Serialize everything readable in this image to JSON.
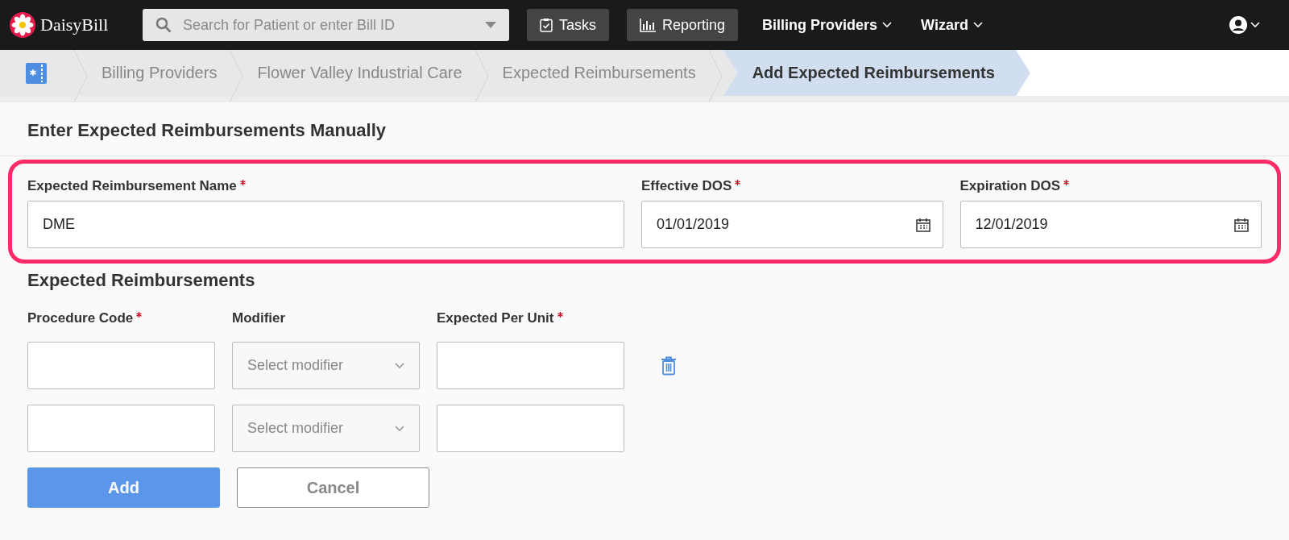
{
  "nav": {
    "logo": "DaisyBill",
    "search": {
      "placeholder": "Search for Patient or enter Bill ID"
    },
    "buttons": [
      {
        "label": "Tasks",
        "kind": "tasks"
      },
      {
        "label": "Reporting",
        "kind": "reporting"
      }
    ],
    "menus": [
      {
        "label": "Billing Providers"
      },
      {
        "label": "Wizard"
      }
    ]
  },
  "breadcrumb": [
    {
      "label": "Billing Providers",
      "selected": false
    },
    {
      "label": "Flower Valley Industrial Care",
      "selected": false
    },
    {
      "label": "Expected Reimbursements",
      "selected": false
    },
    {
      "label": "Add Expected Reimbursements",
      "selected": true
    }
  ],
  "form": {
    "title": "Enter Expected Reimbursements Manually",
    "highlighted": true,
    "fields": [
      {
        "label": "Expected Reimbursement Name",
        "required": true,
        "value": "DME",
        "kind": "text"
      },
      {
        "label": "Effective DOS",
        "required": true,
        "value": "01/01/2019",
        "kind": "date"
      },
      {
        "label": "Expiration DOS",
        "required": true,
        "value": "12/01/2019",
        "kind": "date"
      }
    ]
  },
  "reimbursements": {
    "title": "Expected Reimbursements",
    "columns": [
      {
        "label": "Procedure Code",
        "required": true
      },
      {
        "label": "Modifier",
        "required": false
      },
      {
        "label": "Expected Per Unit",
        "required": true
      }
    ],
    "rows": [
      {
        "modifier": {
          "placeholder": "Select modifier"
        },
        "deletable": true
      },
      {
        "modifier": {
          "placeholder": "Select modifier"
        },
        "deletable": false
      }
    ]
  },
  "buttons": [
    {
      "label": "Add",
      "kind": "primary"
    },
    {
      "label": "Cancel",
      "kind": "secondary"
    }
  ]
}
